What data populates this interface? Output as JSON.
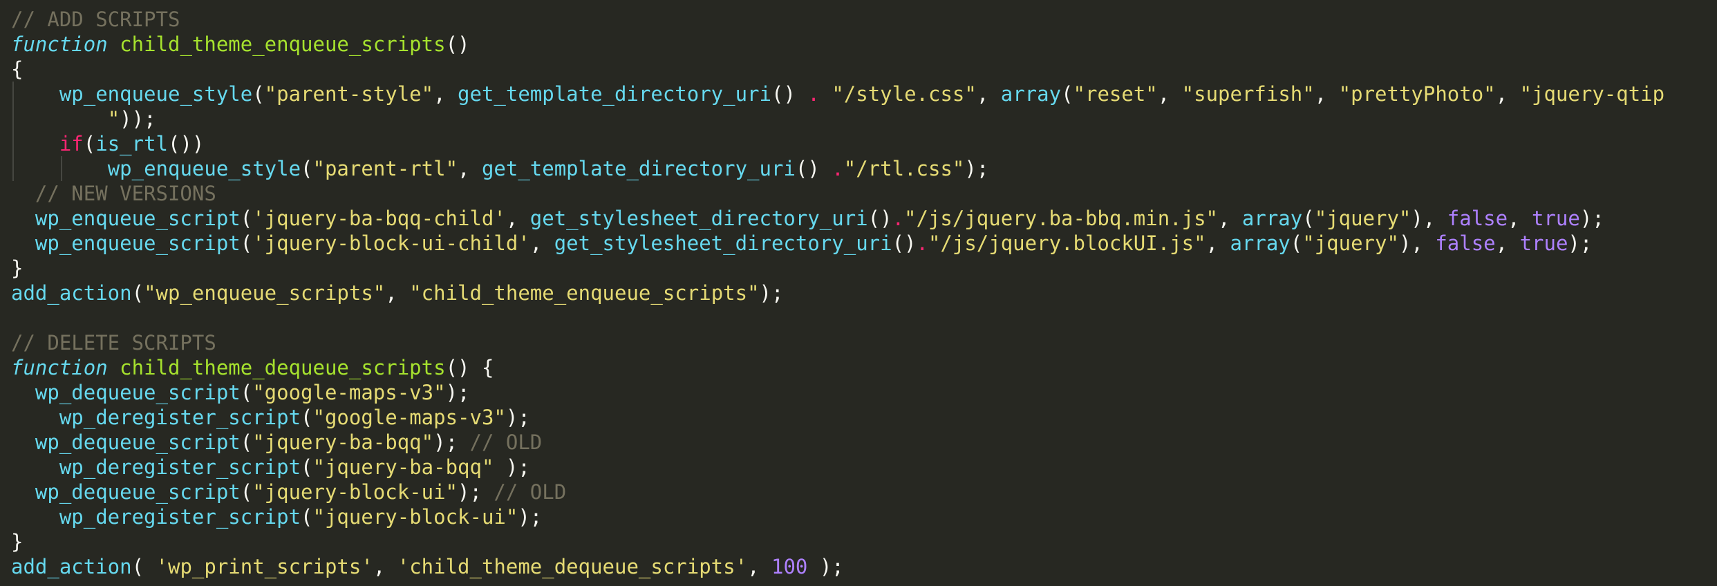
{
  "editor": {
    "language": "php",
    "theme": "monokai",
    "colors": {
      "background": "#272822",
      "plain": "#f8f8f2",
      "comment": "#75715e",
      "keyword": "#66d9ef",
      "function_name": "#a6e22e",
      "builtin": "#66d9ef",
      "string": "#e6db74",
      "operator": "#f92672",
      "constant": "#ae81ff",
      "indent_guide": "#464741"
    },
    "lines": [
      {
        "tokens": [
          {
            "t": "comment",
            "v": "// ADD SCRIPTS"
          }
        ]
      },
      {
        "tokens": [
          {
            "t": "keyword",
            "v": "function"
          },
          {
            "t": "plain",
            "v": " "
          },
          {
            "t": "funcname",
            "v": "child_theme_enqueue_scripts"
          },
          {
            "t": "plain",
            "v": "()"
          }
        ]
      },
      {
        "tokens": [
          {
            "t": "plain",
            "v": "{"
          }
        ]
      },
      {
        "tokens": [
          {
            "t": "plain",
            "v": "    "
          },
          {
            "t": "builtin",
            "v": "wp_enqueue_style"
          },
          {
            "t": "plain",
            "v": "("
          },
          {
            "t": "string",
            "v": "\"parent-style\""
          },
          {
            "t": "plain",
            "v": ", "
          },
          {
            "t": "builtin",
            "v": "get_template_directory_uri"
          },
          {
            "t": "plain",
            "v": "() "
          },
          {
            "t": "operator",
            "v": "."
          },
          {
            "t": "plain",
            "v": " "
          },
          {
            "t": "string",
            "v": "\"/style.css\""
          },
          {
            "t": "plain",
            "v": ", "
          },
          {
            "t": "builtin",
            "v": "array"
          },
          {
            "t": "plain",
            "v": "("
          },
          {
            "t": "string",
            "v": "\"reset\""
          },
          {
            "t": "plain",
            "v": ", "
          },
          {
            "t": "string",
            "v": "\"superfish\""
          },
          {
            "t": "plain",
            "v": ", "
          },
          {
            "t": "string",
            "v": "\"prettyPhoto\""
          },
          {
            "t": "plain",
            "v": ", "
          },
          {
            "t": "string",
            "v": "\"jquery-qtip"
          }
        ]
      },
      {
        "tokens": [
          {
            "t": "plain",
            "v": "        "
          },
          {
            "t": "string",
            "v": "\""
          },
          {
            "t": "plain",
            "v": "));"
          }
        ]
      },
      {
        "tokens": [
          {
            "t": "plain",
            "v": "    "
          },
          {
            "t": "operator",
            "v": "if"
          },
          {
            "t": "plain",
            "v": "("
          },
          {
            "t": "builtin",
            "v": "is_rtl"
          },
          {
            "t": "plain",
            "v": "())"
          }
        ]
      },
      {
        "tokens": [
          {
            "t": "plain",
            "v": "        "
          },
          {
            "t": "builtin",
            "v": "wp_enqueue_style"
          },
          {
            "t": "plain",
            "v": "("
          },
          {
            "t": "string",
            "v": "\"parent-rtl\""
          },
          {
            "t": "plain",
            "v": ", "
          },
          {
            "t": "builtin",
            "v": "get_template_directory_uri"
          },
          {
            "t": "plain",
            "v": "() "
          },
          {
            "t": "operator",
            "v": "."
          },
          {
            "t": "string",
            "v": "\"/rtl.css\""
          },
          {
            "t": "plain",
            "v": ");"
          }
        ]
      },
      {
        "tokens": [
          {
            "t": "plain",
            "v": "  "
          },
          {
            "t": "comment",
            "v": "// NEW VERSIONS"
          }
        ]
      },
      {
        "tokens": [
          {
            "t": "plain",
            "v": "  "
          },
          {
            "t": "builtin",
            "v": "wp_enqueue_script"
          },
          {
            "t": "plain",
            "v": "("
          },
          {
            "t": "string",
            "v": "'jquery-ba-bqq-child'"
          },
          {
            "t": "plain",
            "v": ", "
          },
          {
            "t": "builtin",
            "v": "get_stylesheet_directory_uri"
          },
          {
            "t": "plain",
            "v": "()"
          },
          {
            "t": "operator",
            "v": "."
          },
          {
            "t": "string",
            "v": "\"/js/jquery.ba-bbq.min.js\""
          },
          {
            "t": "plain",
            "v": ", "
          },
          {
            "t": "builtin",
            "v": "array"
          },
          {
            "t": "plain",
            "v": "("
          },
          {
            "t": "string",
            "v": "\"jquery\""
          },
          {
            "t": "plain",
            "v": "), "
          },
          {
            "t": "constant",
            "v": "false"
          },
          {
            "t": "plain",
            "v": ", "
          },
          {
            "t": "constant",
            "v": "true"
          },
          {
            "t": "plain",
            "v": ");"
          }
        ]
      },
      {
        "tokens": [
          {
            "t": "plain",
            "v": "  "
          },
          {
            "t": "builtin",
            "v": "wp_enqueue_script"
          },
          {
            "t": "plain",
            "v": "("
          },
          {
            "t": "string",
            "v": "'jquery-block-ui-child'"
          },
          {
            "t": "plain",
            "v": ", "
          },
          {
            "t": "builtin",
            "v": "get_stylesheet_directory_uri"
          },
          {
            "t": "plain",
            "v": "()"
          },
          {
            "t": "operator",
            "v": "."
          },
          {
            "t": "string",
            "v": "\"/js/jquery.blockUI.js\""
          },
          {
            "t": "plain",
            "v": ", "
          },
          {
            "t": "builtin",
            "v": "array"
          },
          {
            "t": "plain",
            "v": "("
          },
          {
            "t": "string",
            "v": "\"jquery\""
          },
          {
            "t": "plain",
            "v": "), "
          },
          {
            "t": "constant",
            "v": "false"
          },
          {
            "t": "plain",
            "v": ", "
          },
          {
            "t": "constant",
            "v": "true"
          },
          {
            "t": "plain",
            "v": ");"
          }
        ]
      },
      {
        "tokens": [
          {
            "t": "plain",
            "v": "}"
          }
        ]
      },
      {
        "tokens": [
          {
            "t": "builtin",
            "v": "add_action"
          },
          {
            "t": "plain",
            "v": "("
          },
          {
            "t": "string",
            "v": "\"wp_enqueue_scripts\""
          },
          {
            "t": "plain",
            "v": ", "
          },
          {
            "t": "string",
            "v": "\"child_theme_enqueue_scripts\""
          },
          {
            "t": "plain",
            "v": ");"
          }
        ]
      },
      {
        "tokens": []
      },
      {
        "tokens": [
          {
            "t": "comment",
            "v": "// DELETE SCRIPTS"
          }
        ]
      },
      {
        "tokens": [
          {
            "t": "keyword",
            "v": "function"
          },
          {
            "t": "plain",
            "v": " "
          },
          {
            "t": "funcname",
            "v": "child_theme_dequeue_scripts"
          },
          {
            "t": "plain",
            "v": "() {"
          }
        ]
      },
      {
        "tokens": [
          {
            "t": "plain",
            "v": "  "
          },
          {
            "t": "builtin",
            "v": "wp_dequeue_script"
          },
          {
            "t": "plain",
            "v": "("
          },
          {
            "t": "string",
            "v": "\"google-maps-v3\""
          },
          {
            "t": "plain",
            "v": ");"
          }
        ]
      },
      {
        "tokens": [
          {
            "t": "plain",
            "v": "    "
          },
          {
            "t": "builtin",
            "v": "wp_deregister_script"
          },
          {
            "t": "plain",
            "v": "("
          },
          {
            "t": "string",
            "v": "\"google-maps-v3\""
          },
          {
            "t": "plain",
            "v": ");"
          }
        ]
      },
      {
        "tokens": [
          {
            "t": "plain",
            "v": "  "
          },
          {
            "t": "builtin",
            "v": "wp_dequeue_script"
          },
          {
            "t": "plain",
            "v": "("
          },
          {
            "t": "string",
            "v": "\"jquery-ba-bqq\""
          },
          {
            "t": "plain",
            "v": "); "
          },
          {
            "t": "comment",
            "v": "// OLD"
          }
        ]
      },
      {
        "tokens": [
          {
            "t": "plain",
            "v": "    "
          },
          {
            "t": "builtin",
            "v": "wp_deregister_script"
          },
          {
            "t": "plain",
            "v": "("
          },
          {
            "t": "string",
            "v": "\"jquery-ba-bqq\""
          },
          {
            "t": "plain",
            "v": " );"
          }
        ]
      },
      {
        "tokens": [
          {
            "t": "plain",
            "v": "  "
          },
          {
            "t": "builtin",
            "v": "wp_dequeue_script"
          },
          {
            "t": "plain",
            "v": "("
          },
          {
            "t": "string",
            "v": "\"jquery-block-ui\""
          },
          {
            "t": "plain",
            "v": "); "
          },
          {
            "t": "comment",
            "v": "// OLD"
          }
        ]
      },
      {
        "tokens": [
          {
            "t": "plain",
            "v": "    "
          },
          {
            "t": "builtin",
            "v": "wp_deregister_script"
          },
          {
            "t": "plain",
            "v": "("
          },
          {
            "t": "string",
            "v": "\"jquery-block-ui\""
          },
          {
            "t": "plain",
            "v": ");"
          }
        ]
      },
      {
        "tokens": [
          {
            "t": "plain",
            "v": "}"
          }
        ]
      },
      {
        "tokens": [
          {
            "t": "builtin",
            "v": "add_action"
          },
          {
            "t": "plain",
            "v": "( "
          },
          {
            "t": "string",
            "v": "'wp_print_scripts'"
          },
          {
            "t": "plain",
            "v": ", "
          },
          {
            "t": "string",
            "v": "'child_theme_dequeue_scripts'"
          },
          {
            "t": "plain",
            "v": ", "
          },
          {
            "t": "constant",
            "v": "100"
          },
          {
            "t": "plain",
            "v": " );"
          }
        ]
      }
    ]
  }
}
